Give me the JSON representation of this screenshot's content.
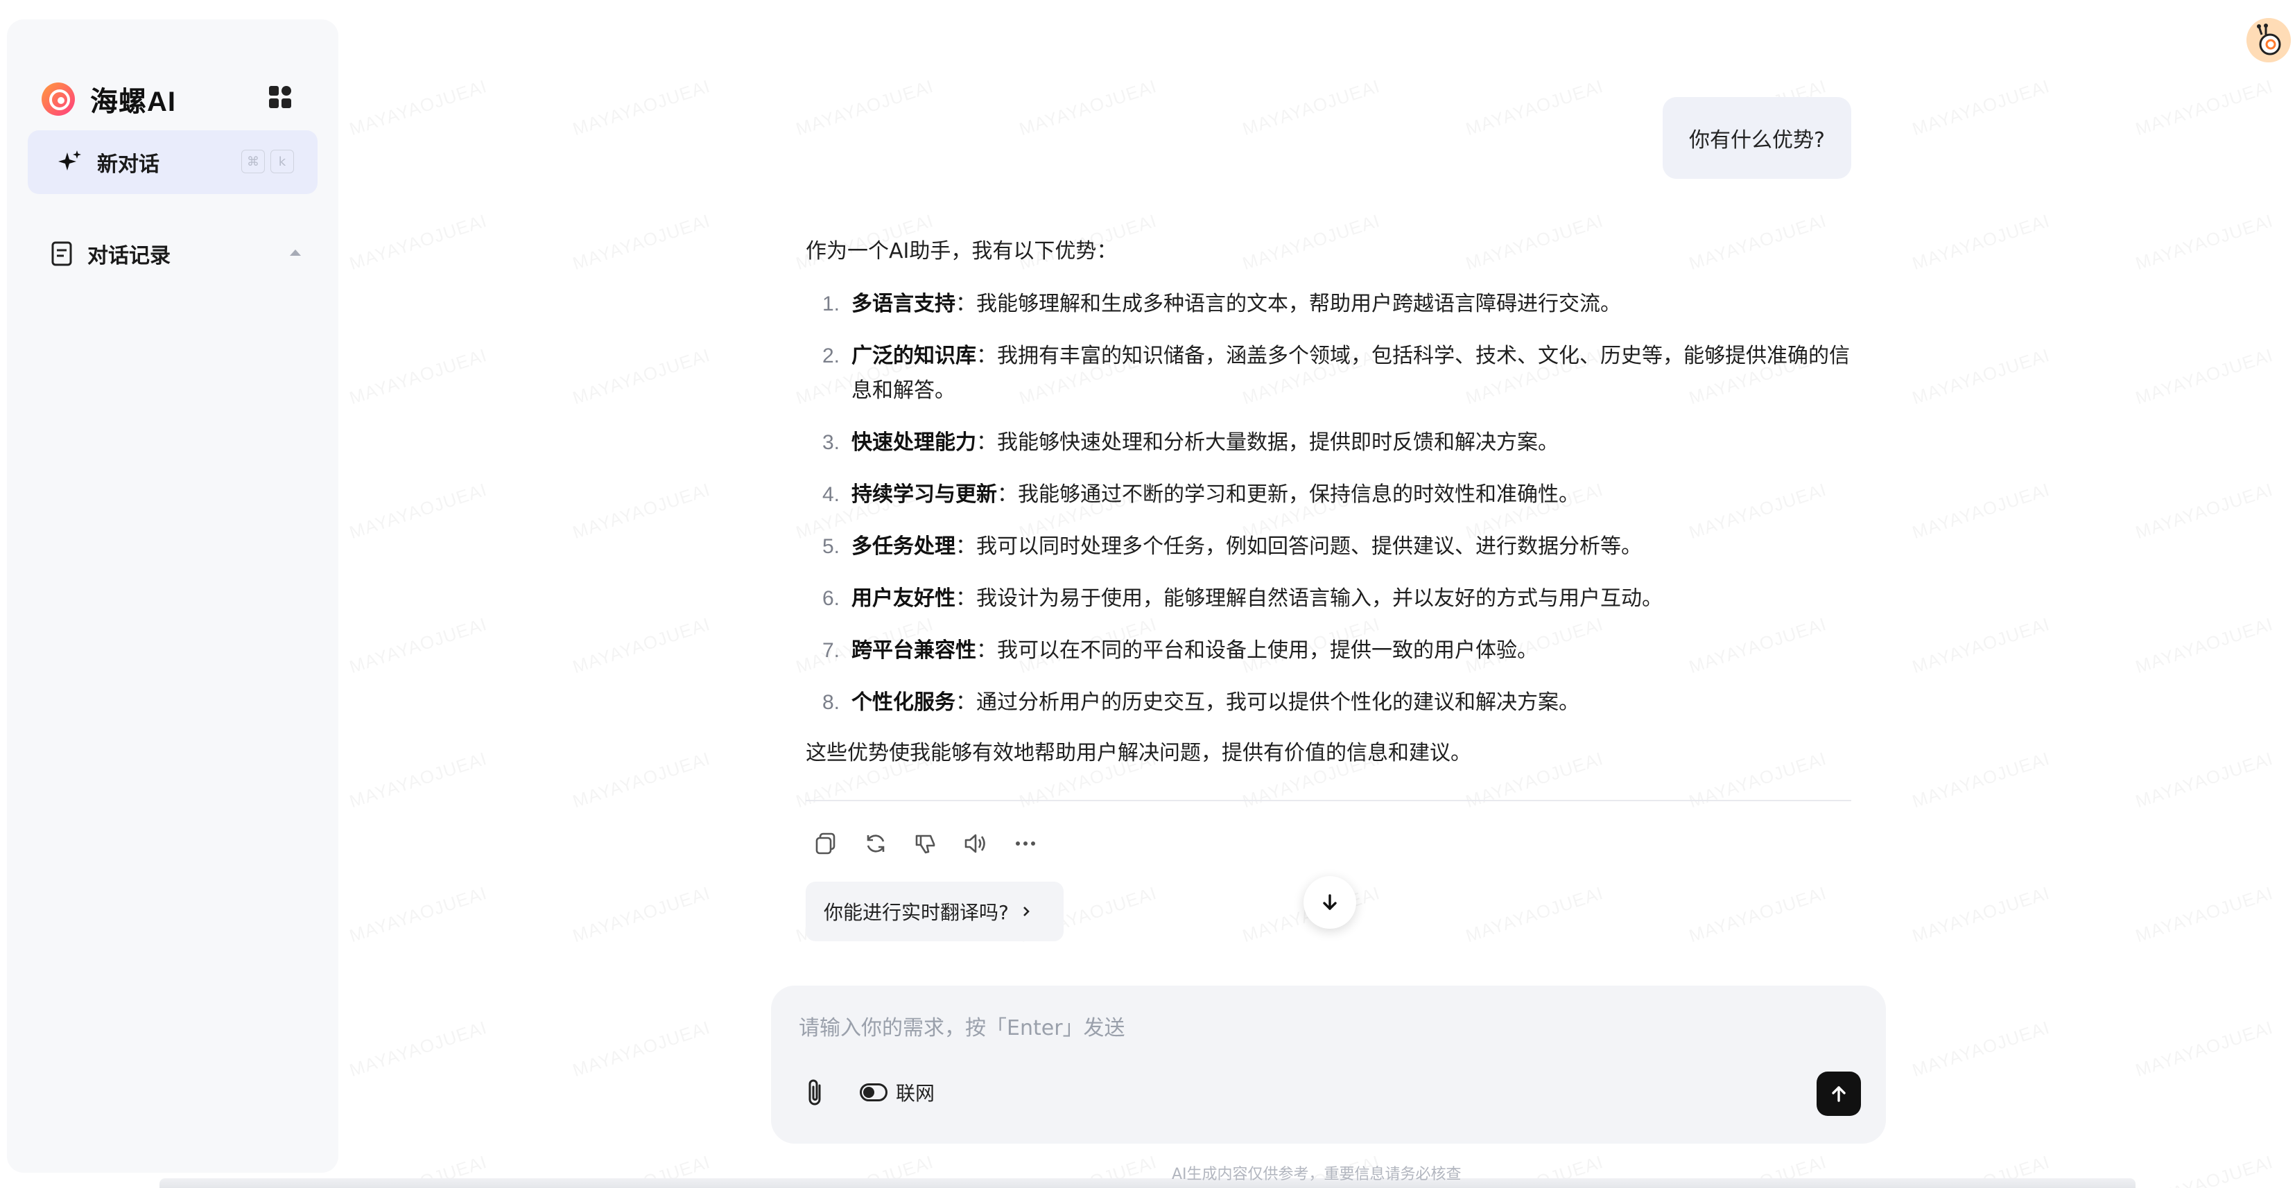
{
  "app": {
    "brand_name": "海螺AI",
    "accent_color": "#e9ecfb"
  },
  "sidebar": {
    "new_chat_label": "新对话",
    "shortcut_keys": [
      "⌘",
      "k"
    ],
    "history_label": "对话记录"
  },
  "conversation": {
    "user_message": "你有什么优势?",
    "answer": {
      "intro": "作为一个AI助手，我有以下优势：",
      "items": [
        {
          "num": "1.",
          "title": "多语言支持",
          "text": "：我能够理解和生成多种语言的文本，帮助用户跨越语言障碍进行交流。"
        },
        {
          "num": "2.",
          "title": "广泛的知识库",
          "text": "：我拥有丰富的知识储备，涵盖多个领域，包括科学、技术、文化、历史等，能够提供准确的信息和解答。"
        },
        {
          "num": "3.",
          "title": "快速处理能力",
          "text": "：我能够快速处理和分析大量数据，提供即时反馈和解决方案。"
        },
        {
          "num": "4.",
          "title": "持续学习与更新",
          "text": "：我能够通过不断的学习和更新，保持信息的时效性和准确性。"
        },
        {
          "num": "5.",
          "title": "多任务处理",
          "text": "：我可以同时处理多个任务，例如回答问题、提供建议、进行数据分析等。"
        },
        {
          "num": "6.",
          "title": "用户友好性",
          "text": "：我设计为易于使用，能够理解自然语言输入，并以友好的方式与用户互动。"
        },
        {
          "num": "7.",
          "title": "跨平台兼容性",
          "text": "：我可以在不同的平台和设备上使用，提供一致的用户体验。"
        },
        {
          "num": "8.",
          "title": "个性化服务",
          "text": "：通过分析用户的历史交互，我可以提供个性化的建议和解决方案。"
        }
      ],
      "outro": "这些优势使我能够有效地帮助用户解决问题，提供有价值的信息和建议。"
    },
    "suggestion": "你能进行实时翻译吗?"
  },
  "composer": {
    "placeholder": "请输入你的需求，按「Enter」发送",
    "value": "",
    "web_toggle_label": "联网"
  },
  "footer": {
    "note": "AI生成内容仅供参考，重要信息请务必核查"
  },
  "watermark_text": "MAYAYAOJUEAI"
}
